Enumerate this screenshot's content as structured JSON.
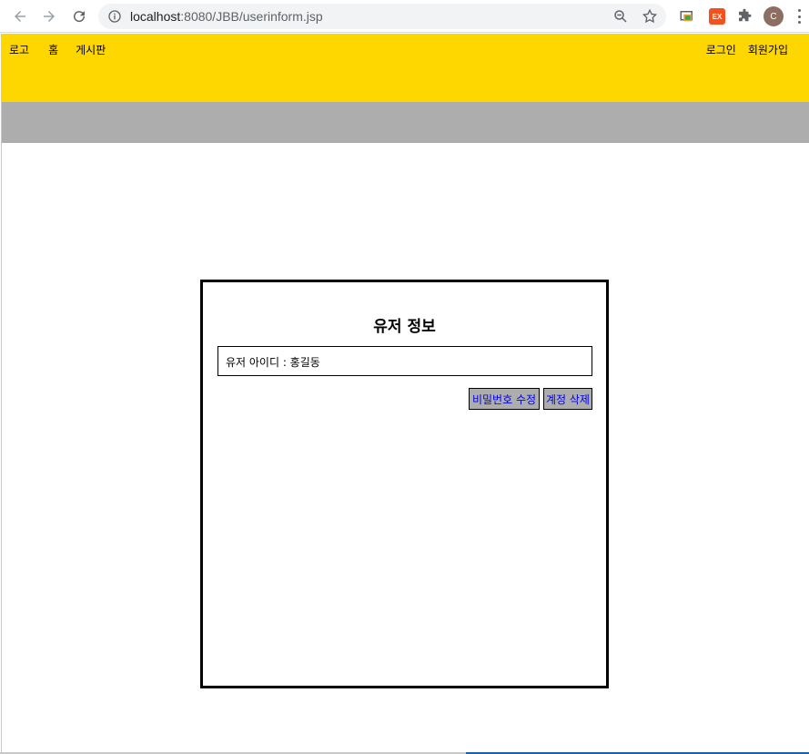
{
  "browser": {
    "url_host": "localhost",
    "url_path": ":8080/JBB/userinform.jsp",
    "avatar_letter": "C",
    "ext_label": "EX"
  },
  "nav": {
    "logo": "로고",
    "home": "홈",
    "board": "게시판",
    "login": "로그인",
    "signup": "회원가입"
  },
  "colors": {
    "topbar": "#ffd700",
    "subbar": "#adadad",
    "button_bg": "#adadad",
    "button_text": "#0000ee"
  },
  "card": {
    "title": "유저 정보",
    "user_id_text": "유저 아이디 : 홍길동",
    "change_password_label": "비밀번호 수정",
    "delete_account_label": "계정 삭제"
  }
}
